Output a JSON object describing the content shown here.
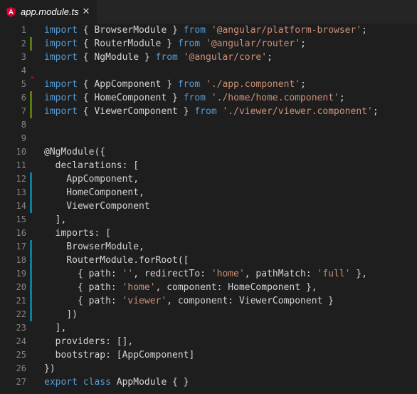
{
  "tab": {
    "title": "app.module.ts",
    "icon": "angular-icon",
    "close_glyph": "✕"
  },
  "colors": {
    "keyword": "#569cd6",
    "string": "#ce9178",
    "gutter_added": "#587c0c",
    "gutter_modified": "#0c7d9d",
    "gutter_deleted": "#94151b"
  },
  "lines": [
    {
      "n": "1",
      "mark": "",
      "tokens": [
        [
          "kw",
          "import"
        ],
        [
          "id",
          " { BrowserModule } "
        ],
        [
          "kw",
          "from"
        ],
        [
          "id",
          " "
        ],
        [
          "str",
          "'@angular/platform-browser'"
        ],
        [
          "id",
          ";"
        ]
      ]
    },
    {
      "n": "2",
      "mark": "added",
      "tokens": [
        [
          "kw",
          "import"
        ],
        [
          "id",
          " { RouterModule } "
        ],
        [
          "kw",
          "from"
        ],
        [
          "id",
          " "
        ],
        [
          "str",
          "'@angular/router'"
        ],
        [
          "id",
          ";"
        ]
      ]
    },
    {
      "n": "3",
      "mark": "",
      "tokens": [
        [
          "kw",
          "import"
        ],
        [
          "id",
          " { NgModule } "
        ],
        [
          "kw",
          "from"
        ],
        [
          "id",
          " "
        ],
        [
          "str",
          "'@angular/core'"
        ],
        [
          "id",
          ";"
        ]
      ]
    },
    {
      "n": "4",
      "mark": "",
      "tokens": []
    },
    {
      "n": "5",
      "mark": "deleted",
      "tokens": [
        [
          "kw",
          "import"
        ],
        [
          "id",
          " { AppComponent } "
        ],
        [
          "kw",
          "from"
        ],
        [
          "id",
          " "
        ],
        [
          "str",
          "'./app.component'"
        ],
        [
          "id",
          ";"
        ]
      ]
    },
    {
      "n": "6",
      "mark": "added",
      "tokens": [
        [
          "kw",
          "import"
        ],
        [
          "id",
          " { HomeComponent } "
        ],
        [
          "kw",
          "from"
        ],
        [
          "id",
          " "
        ],
        [
          "str",
          "'./home/home.component'"
        ],
        [
          "id",
          ";"
        ]
      ]
    },
    {
      "n": "7",
      "mark": "added",
      "tokens": [
        [
          "kw",
          "import"
        ],
        [
          "id",
          " { ViewerComponent } "
        ],
        [
          "kw",
          "from"
        ],
        [
          "id",
          " "
        ],
        [
          "str",
          "'./viewer/viewer.component'"
        ],
        [
          "id",
          ";"
        ]
      ]
    },
    {
      "n": "8",
      "mark": "",
      "tokens": []
    },
    {
      "n": "9",
      "mark": "",
      "tokens": []
    },
    {
      "n": "10",
      "mark": "",
      "tokens": [
        [
          "id",
          "@NgModule({"
        ]
      ]
    },
    {
      "n": "11",
      "mark": "",
      "tokens": [
        [
          "id",
          "  declarations: ["
        ]
      ]
    },
    {
      "n": "12",
      "mark": "modified",
      "tokens": [
        [
          "id",
          "    AppComponent,"
        ]
      ]
    },
    {
      "n": "13",
      "mark": "modified",
      "tokens": [
        [
          "id",
          "    HomeComponent,"
        ]
      ]
    },
    {
      "n": "14",
      "mark": "modified",
      "tokens": [
        [
          "id",
          "    ViewerComponent"
        ]
      ]
    },
    {
      "n": "15",
      "mark": "",
      "tokens": [
        [
          "id",
          "  ],"
        ]
      ]
    },
    {
      "n": "16",
      "mark": "",
      "tokens": [
        [
          "id",
          "  imports: ["
        ]
      ]
    },
    {
      "n": "17",
      "mark": "modified",
      "tokens": [
        [
          "id",
          "    BrowserModule,"
        ]
      ]
    },
    {
      "n": "18",
      "mark": "modified",
      "tokens": [
        [
          "id",
          "    RouterModule.forRoot(["
        ]
      ]
    },
    {
      "n": "19",
      "mark": "modified",
      "tokens": [
        [
          "id",
          "      { path: "
        ],
        [
          "str",
          "''"
        ],
        [
          "id",
          ", redirectTo: "
        ],
        [
          "str",
          "'home'"
        ],
        [
          "id",
          ", pathMatch: "
        ],
        [
          "str",
          "'full'"
        ],
        [
          "id",
          " },"
        ]
      ]
    },
    {
      "n": "20",
      "mark": "modified",
      "tokens": [
        [
          "id",
          "      { path: "
        ],
        [
          "str",
          "'home'"
        ],
        [
          "id",
          ", component: HomeComponent },"
        ]
      ]
    },
    {
      "n": "21",
      "mark": "modified",
      "tokens": [
        [
          "id",
          "      { path: "
        ],
        [
          "str",
          "'viewer'"
        ],
        [
          "id",
          ", component: ViewerComponent }"
        ]
      ]
    },
    {
      "n": "22",
      "mark": "modified",
      "tokens": [
        [
          "id",
          "    ])"
        ]
      ]
    },
    {
      "n": "23",
      "mark": "",
      "tokens": [
        [
          "id",
          "  ],"
        ]
      ]
    },
    {
      "n": "24",
      "mark": "",
      "tokens": [
        [
          "id",
          "  providers: [],"
        ]
      ]
    },
    {
      "n": "25",
      "mark": "",
      "tokens": [
        [
          "id",
          "  bootstrap: [AppComponent]"
        ]
      ]
    },
    {
      "n": "26",
      "mark": "",
      "tokens": [
        [
          "id",
          "})"
        ]
      ]
    },
    {
      "n": "27",
      "mark": "",
      "tokens": [
        [
          "kw",
          "export"
        ],
        [
          "id",
          " "
        ],
        [
          "kw",
          "class"
        ],
        [
          "id",
          " AppModule { }"
        ]
      ]
    }
  ]
}
